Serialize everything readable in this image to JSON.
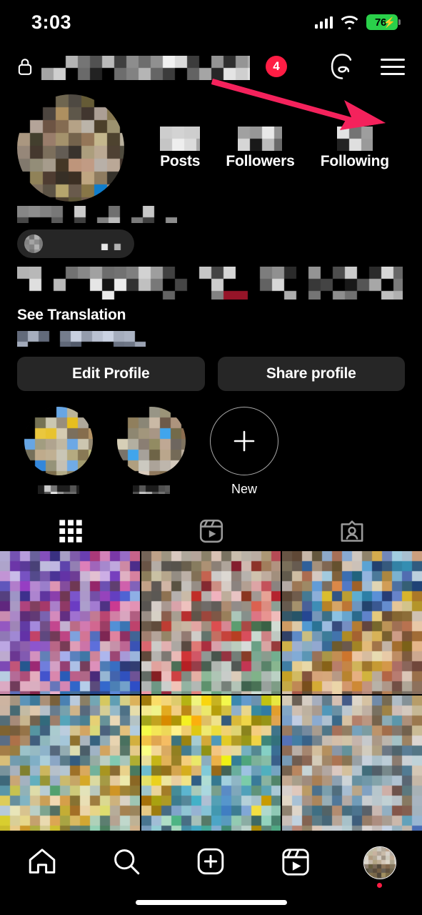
{
  "status_bar": {
    "time": "3:03",
    "battery_percent": "76",
    "battery_charging": true,
    "battery_color": "#2ad04a",
    "wifi_icon": "wifi-icon",
    "cellular_icon": "cellular-signal-icon"
  },
  "header": {
    "lock_icon": "lock-icon",
    "username_redacted": true,
    "notification_badge": "4",
    "badge_color": "#FF1D44",
    "threads_icon": "threads-icon",
    "menu_icon": "hamburger-menu-icon"
  },
  "annotation": {
    "type": "arrow",
    "points_to": "hamburger-menu-icon",
    "color": "#F4225C"
  },
  "profile": {
    "avatar_redacted": true,
    "stats": [
      {
        "label": "Posts",
        "value_redacted": true
      },
      {
        "label": "Followers",
        "value_redacted": true
      },
      {
        "label": "Following",
        "value_redacted": true
      }
    ],
    "display_name_redacted": true,
    "category_pill_redacted": true,
    "bio_redacted": true,
    "see_translation": "See Translation",
    "extra_line_redacted": true
  },
  "actions": {
    "edit_profile": "Edit Profile",
    "share_profile": "Share profile"
  },
  "highlights": [
    {
      "label_redacted": true,
      "cover_redacted": true
    },
    {
      "label_redacted": true,
      "cover_redacted": true
    },
    {
      "label": "New",
      "icon": "plus-icon"
    }
  ],
  "tabs": [
    {
      "name": "grid",
      "icon": "grid-icon",
      "active": true
    },
    {
      "name": "reels",
      "icon": "reels-icon",
      "active": false
    },
    {
      "name": "tagged",
      "icon": "tagged-icon",
      "active": false
    }
  ],
  "grid": {
    "columns": 3,
    "visible_rows": 2,
    "cells_redacted": true
  },
  "bottom_nav": [
    {
      "name": "home",
      "icon": "home-icon"
    },
    {
      "name": "search",
      "icon": "search-icon"
    },
    {
      "name": "create",
      "icon": "plus-square-icon"
    },
    {
      "name": "reels",
      "icon": "reels-icon"
    },
    {
      "name": "profile",
      "icon": "avatar-icon",
      "has_dot": true
    }
  ],
  "colors": {
    "background": "#000000",
    "button": "#262626",
    "accent_red": "#FF1D44",
    "annotation": "#F4225C"
  }
}
